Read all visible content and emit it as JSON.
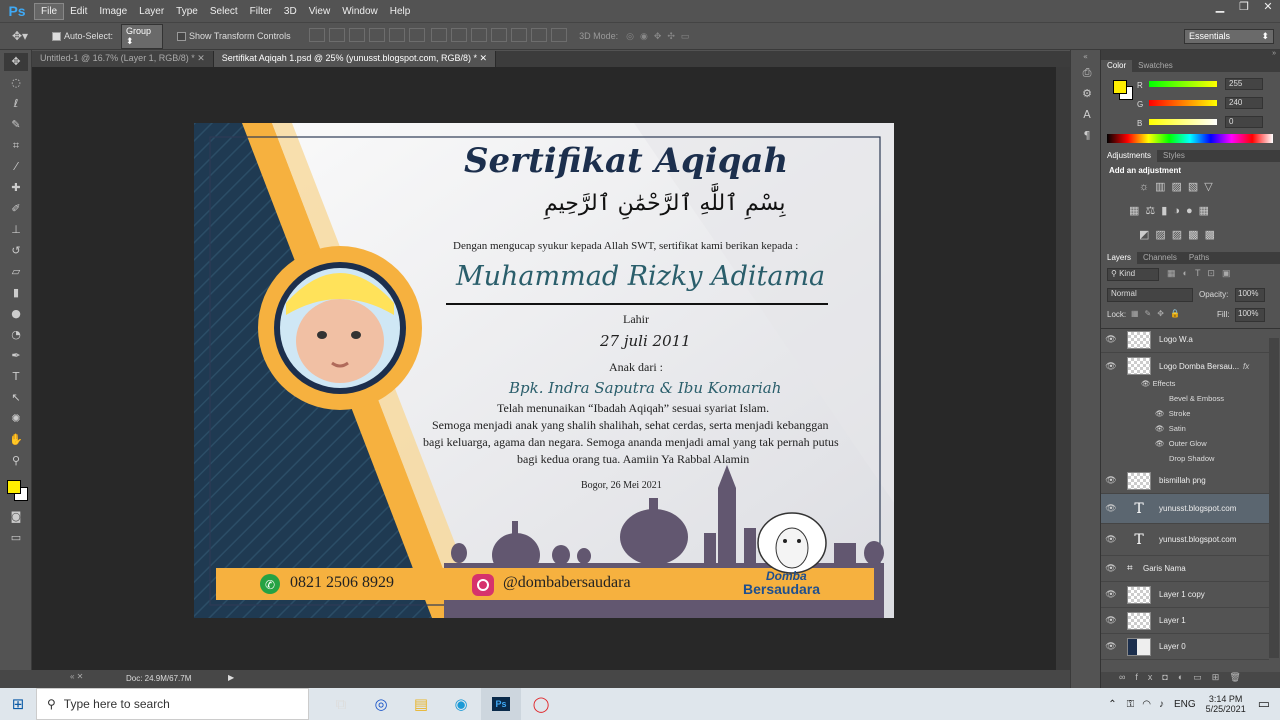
{
  "app": {
    "logo": "Ps"
  },
  "menu": [
    "File",
    "Edit",
    "Image",
    "Layer",
    "Type",
    "Select",
    "Filter",
    "3D",
    "View",
    "Window",
    "Help"
  ],
  "options": {
    "auto_select": "Auto-Select:",
    "group": "Group",
    "show_transform": "Show Transform Controls",
    "mode3d": "3D Mode:",
    "workspace": "Essentials"
  },
  "tabs": [
    "Untitled-1 @ 16.7% (Layer 1, RGB/8) *",
    "Sertifikat Aqiqah 1.psd @ 25% (yunusst.blogspot.com, RGB/8) *"
  ],
  "certificate": {
    "title": "Sertifikat Aqiqah",
    "bismillah": "بِسْمِ ٱللَّٰهِ ٱلرَّحْمَٰنِ ٱلرَّحِيمِ",
    "intro": "Dengan mengucap syukur kepada Allah SWT, sertifikat kami berikan kepada :",
    "name": "Muhammad Rizky Aditama",
    "born_label": "Lahir",
    "born_date": "27 juli 2011",
    "child_of": "Anak dari :",
    "parents": "Bpk. Indra Saputra & Ibu Komariah",
    "line1": "Telah menunaikan “Ibadah Aqiqah” sesuai syariat Islam.",
    "line2": "Semoga menjadi anak yang shalih shalihah, sehat cerdas, serta menjadi kebanggan",
    "line3": "bagi keluarga, agama dan negara. Semoga ananda menjadi amal yang tak pernah putus",
    "line4": "bagi kedua orang tua. Aamiin Ya Rabbal Alamin",
    "place_date": "Bogor, 26 Mei 2021",
    "phone": "0821 2506 8929",
    "instagram": "@dombabersaudara",
    "brand1": "Domba",
    "brand2": "Bersaudara",
    "colors": {
      "navy": "#1c2f4d",
      "gold": "#f6b13f",
      "mosque": "#625770"
    }
  },
  "status": {
    "doc": "Doc: 24.9M/67.7M"
  },
  "color_panel": {
    "tabs": [
      "Color",
      "Swatches"
    ],
    "r_label": "R",
    "g_label": "G",
    "b_label": "B",
    "r": "255",
    "g": "240",
    "b": "0",
    "foreground": "#ffee00"
  },
  "adjustments": {
    "tabs": [
      "Adjustments",
      "Styles"
    ],
    "hint": "Add an adjustment"
  },
  "layers_panel": {
    "tabs": [
      "Layers",
      "Channels",
      "Paths"
    ],
    "kind": "Kind",
    "blend": "Normal",
    "opacity_label": "Opacity:",
    "opacity": "100%",
    "lock_label": "Lock:",
    "fill_label": "Fill:",
    "fill": "100%",
    "effects_label": "Effects",
    "effects": [
      "Bevel & Emboss",
      "Stroke",
      "Satin",
      "Outer Glow",
      "Drop Shadow"
    ],
    "fx": "fx",
    "layers": [
      {
        "name": "Logo W.a"
      },
      {
        "name": "Logo Domba Bersau..."
      },
      {
        "name": "bismillah png"
      },
      {
        "name": "yunusst.blogspot.com"
      },
      {
        "name": "yunusst.blogspot.com"
      },
      {
        "name": "Garis Nama"
      },
      {
        "name": "Layer 1 copy"
      },
      {
        "name": "Layer 1"
      },
      {
        "name": "Layer 0"
      }
    ]
  },
  "taskbar": {
    "search_placeholder": "Type here to search",
    "lang": "ENG",
    "time": "3:14 PM",
    "date": "5/25/2021"
  }
}
